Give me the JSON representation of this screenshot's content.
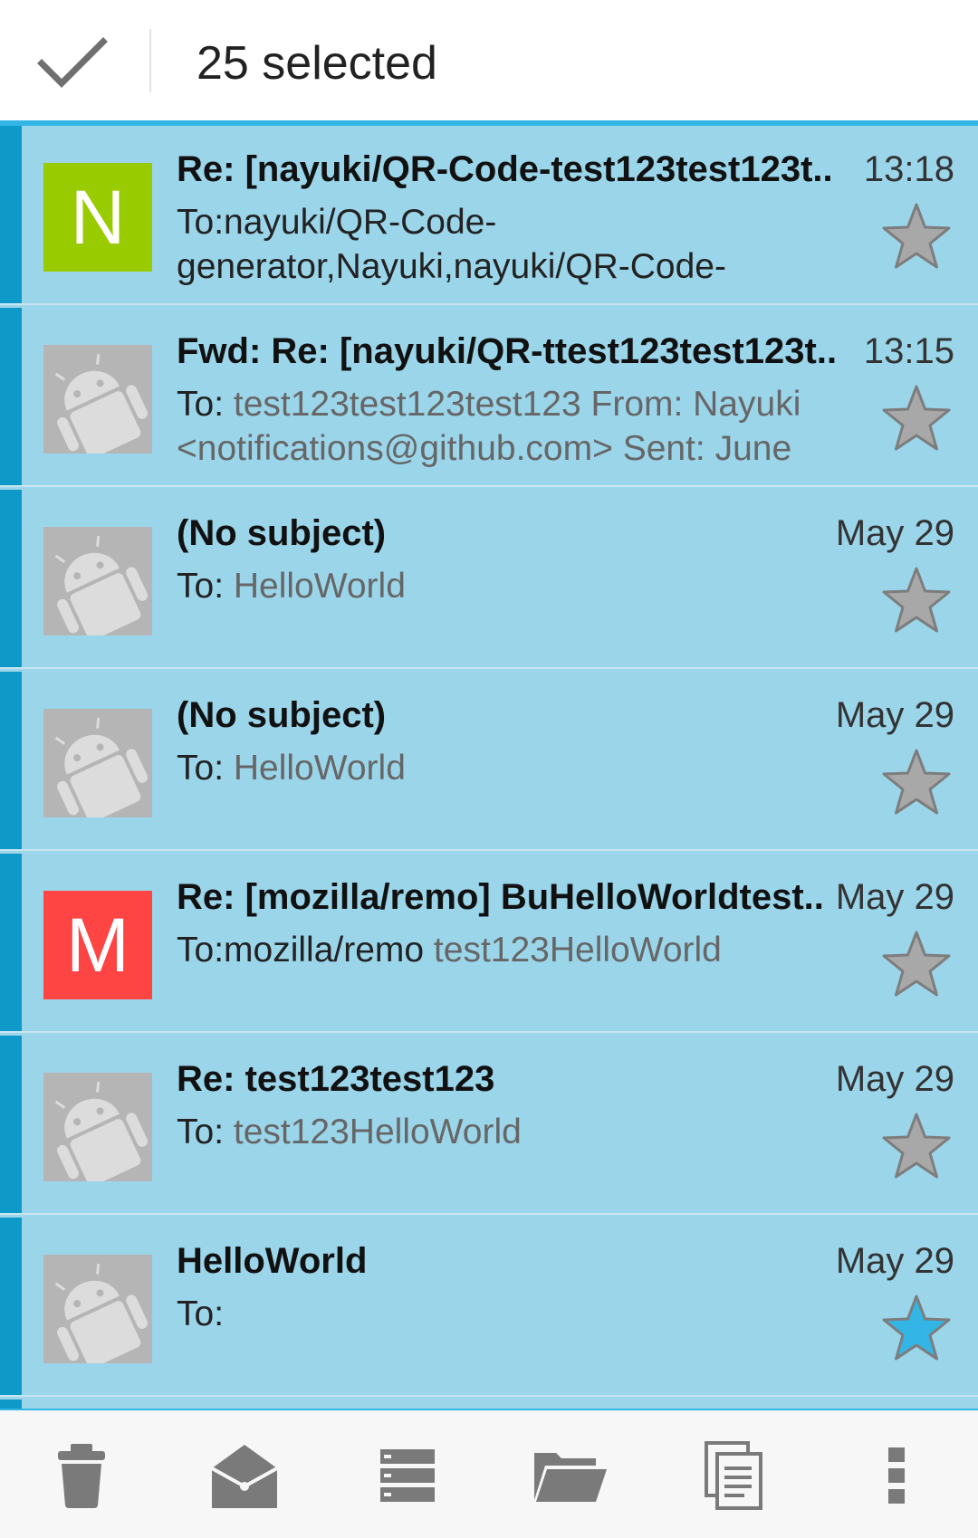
{
  "action_bar": {
    "title": "25 selected",
    "done_icon": "check-icon"
  },
  "messages": [
    {
      "subject": "Re: [nayuki/QR-Code-test123test123t..",
      "date": "13:18",
      "to_label": "To:",
      "to_value": "nayuki/QR-Code-generator,Nayuki,nayuki/QR-Code-",
      "preview": "",
      "avatar_type": "letter",
      "avatar_letter": "N",
      "avatar_color": "#99cc00",
      "starred": false
    },
    {
      "subject": "Fwd: Re: [nayuki/QR-ttest123test123t..",
      "date": "13:15",
      "to_label": "To: ",
      "to_value": "",
      "preview": "test123test123test123 From: Nayuki <notifications@github.com> Sent: June",
      "avatar_type": "android",
      "avatar_letter": "",
      "avatar_color": "#b8b8b8",
      "starred": false
    },
    {
      "subject": "(No subject)",
      "date": "May 29",
      "to_label": "To: ",
      "to_value": "",
      "preview": "HelloWorld",
      "avatar_type": "android",
      "avatar_letter": "",
      "avatar_color": "#b8b8b8",
      "starred": false
    },
    {
      "subject": "(No subject)",
      "date": "May 29",
      "to_label": "To: ",
      "to_value": "",
      "preview": "HelloWorld",
      "avatar_type": "android",
      "avatar_letter": "",
      "avatar_color": "#b8b8b8",
      "starred": false
    },
    {
      "subject": "Re: [mozilla/remo] BuHelloWorldtest..",
      "date": "May 29",
      "to_label": "To:",
      "to_value": "mozilla/remo ",
      "preview": "test123HelloWorld",
      "avatar_type": "letter",
      "avatar_letter": "M",
      "avatar_color": "#ff4444",
      "starred": false
    },
    {
      "subject": "Re: test123test123",
      "date": "May 29",
      "to_label": "To: ",
      "to_value": "",
      "preview": "test123HelloWorld",
      "avatar_type": "android",
      "avatar_letter": "",
      "avatar_color": "#b8b8b8",
      "starred": false
    },
    {
      "subject": "HelloWorld",
      "date": "May 29",
      "to_label": "To:",
      "to_value": "",
      "preview": "",
      "avatar_type": "android",
      "avatar_letter": "",
      "avatar_color": "#b8b8b8",
      "starred": true
    }
  ],
  "bottom_toolbar": [
    {
      "icon": "trash-icon"
    },
    {
      "icon": "mark-read-icon"
    },
    {
      "icon": "move-list-icon"
    },
    {
      "icon": "folder-icon"
    },
    {
      "icon": "copy-icon"
    },
    {
      "icon": "overflow-menu-icon"
    }
  ],
  "colors": {
    "accent": "#33b5e5",
    "selected_row": "#9bd5ea",
    "selection_bar": "#0e99c8",
    "star_off": "#a8a8a8",
    "star_on": "#33b5e5"
  }
}
